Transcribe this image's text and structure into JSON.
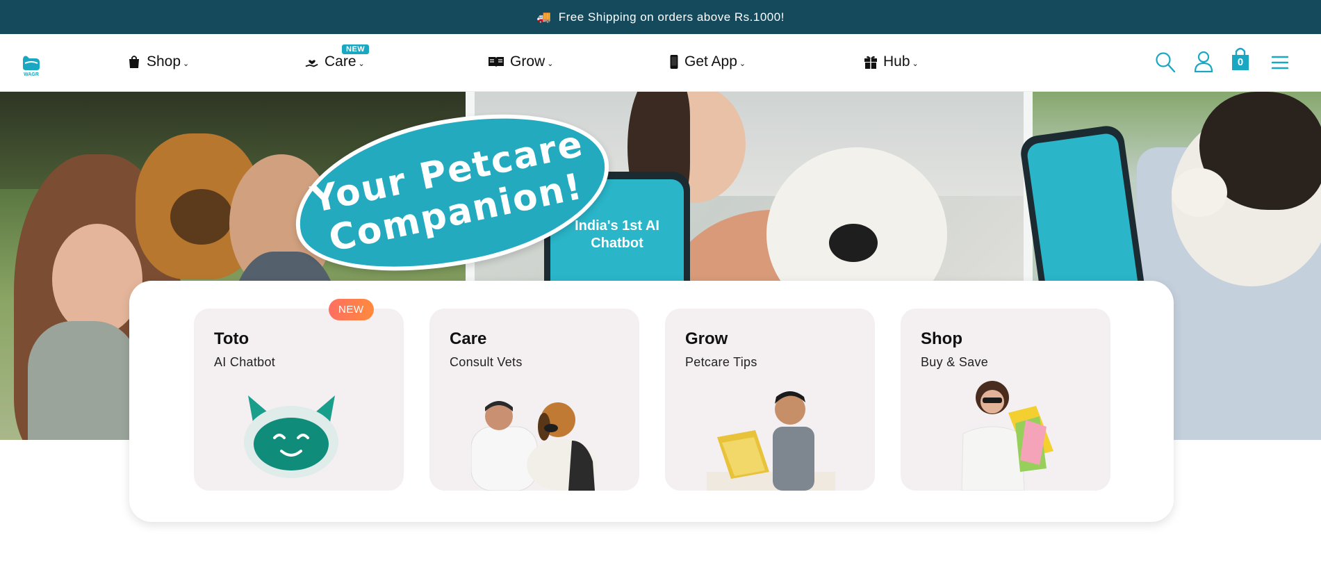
{
  "announcement": {
    "icon": "truck-icon",
    "text": "Free Shipping on orders above Rs.1000!"
  },
  "header": {
    "logo_text": "WAGR",
    "nav": [
      {
        "label": "Shop",
        "icon": "shopping-bag-icon"
      },
      {
        "label": "Care",
        "icon": "hand-heart-icon",
        "badge": "NEW"
      },
      {
        "label": "Grow",
        "icon": "open-book-icon"
      },
      {
        "label": "Get App",
        "icon": "mobile-phone-icon"
      },
      {
        "label": "Hub",
        "icon": "gift-box-icon"
      }
    ],
    "cart_count": "0"
  },
  "hero": {
    "headline_line1": "Your Petcare",
    "headline_line2": "Companion!",
    "phone_text_line1": "India's 1st AI",
    "phone_text_line2": "Chatbot"
  },
  "cards": [
    {
      "title": "Toto",
      "subtitle": "AI Chatbot",
      "badge": "NEW"
    },
    {
      "title": "Care",
      "subtitle": "Consult Vets"
    },
    {
      "title": "Grow",
      "subtitle": "Petcare Tips"
    },
    {
      "title": "Shop",
      "subtitle": "Buy & Save"
    }
  ],
  "colors": {
    "brand": "#1aa7c1",
    "announcement_bg": "#154a5d",
    "card_bg": "#f4f0f2",
    "badge": "#ff7a4f"
  }
}
